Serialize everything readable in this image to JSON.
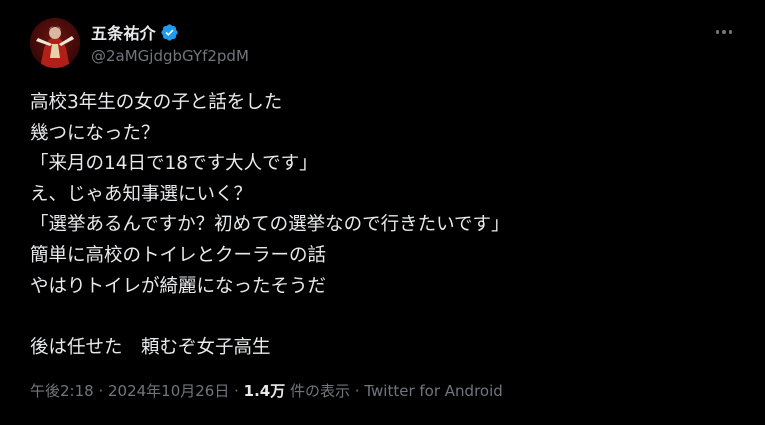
{
  "author": {
    "display_name": "五条祐介",
    "handle": "@2aMGjdgbGYf2pdM",
    "verified": true
  },
  "tweet": {
    "lines": [
      "高校3年生の女の子と話をした",
      "幾つになった？",
      "「来月の14日で18です大人です」",
      "え、じゃあ知事選にいく？",
      "「選挙あるんですか？初めての選挙なので行きたいです」",
      "簡単に高校のトイレとクーラーの話",
      "やはりトイレが綺麗になったそうだ",
      "",
      "後は任せた　頼むぞ女子高生"
    ]
  },
  "meta": {
    "time": "午後2:18",
    "sep1": " · ",
    "date": "2024年10月26日",
    "sep2": " · ",
    "views_count": "1.4万",
    "views_label": " 件の表示",
    "sep3": " · ",
    "source": "Twitter for Android"
  },
  "icons": {
    "more": "more-options-icon",
    "verified": "verified-badge-icon"
  },
  "colors": {
    "background": "#000000",
    "text_primary": "#e7e9ea",
    "text_secondary": "#71767b",
    "verified_blue": "#1d9bf0"
  }
}
